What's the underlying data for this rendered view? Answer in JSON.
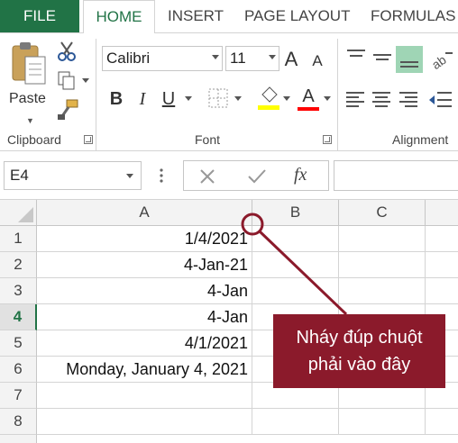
{
  "tabs": {
    "file": "FILE",
    "home": "HOME",
    "insert": "INSERT",
    "page_layout": "PAGE LAYOUT",
    "formulas": "FORMULAS"
  },
  "ribbon": {
    "clipboard": {
      "paste_label": "Paste",
      "group_label": "Clipboard"
    },
    "font": {
      "name": "Calibri",
      "size": "11",
      "group_label": "Font",
      "bold": "B",
      "italic": "I",
      "underline": "U",
      "grow": "A",
      "shrink": "A",
      "font_color": "A"
    },
    "alignment": {
      "group_label": "Alignment"
    }
  },
  "formula_bar": {
    "name_box": "E4",
    "fx": "fx",
    "value": ""
  },
  "grid": {
    "columns": [
      "A",
      "B",
      "C"
    ],
    "rows": [
      {
        "num": "1",
        "a": "1/4/2021"
      },
      {
        "num": "2",
        "a": "4-Jan-21"
      },
      {
        "num": "3",
        "a": "4-Jan"
      },
      {
        "num": "4",
        "a": "4-Jan"
      },
      {
        "num": "5",
        "a": "4/1/2021"
      },
      {
        "num": "6",
        "a": "Monday, January 4, 2021"
      },
      {
        "num": "7",
        "a": ""
      },
      {
        "num": "8",
        "a": ""
      }
    ],
    "active_row": "4"
  },
  "annotation": {
    "line1": "Nháy đúp chuột",
    "line2": "phải vào đây"
  },
  "colors": {
    "excel_green": "#217346",
    "callout": "#8b1a2b",
    "highlight": "#ffff00",
    "font_red": "#ff0000"
  }
}
